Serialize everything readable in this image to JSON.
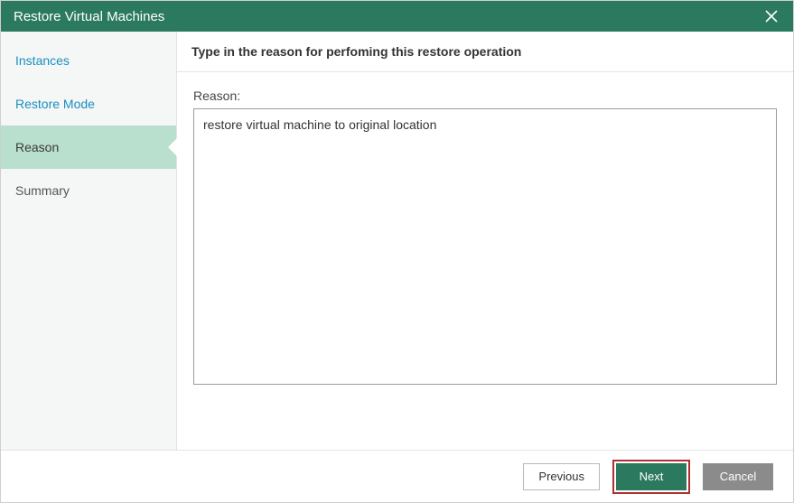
{
  "window": {
    "title": "Restore Virtual Machines"
  },
  "sidebar": {
    "steps": [
      {
        "label": "Instances",
        "state": "link"
      },
      {
        "label": "Restore Mode",
        "state": "link"
      },
      {
        "label": "Reason",
        "state": "current"
      },
      {
        "label": "Summary",
        "state": "upcoming"
      }
    ]
  },
  "main": {
    "instruction": "Type in the reason for perfoming this restore operation",
    "reason_label": "Reason:",
    "reason_value": "restore virtual machine to original location"
  },
  "footer": {
    "previous": "Previous",
    "next": "Next",
    "cancel": "Cancel"
  }
}
